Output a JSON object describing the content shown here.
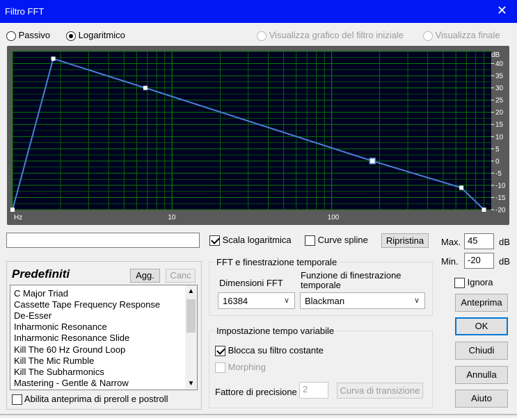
{
  "window": {
    "title": "Filtro FFT",
    "close_glyph": "✕"
  },
  "mode_options": [
    {
      "label": "Passivo",
      "selected": false
    },
    {
      "label": "Logaritmico",
      "selected": true
    }
  ],
  "view_options": [
    {
      "label": "Visualizza grafico del filtro iniziale",
      "enabled": false
    },
    {
      "label": "Visualizza finale",
      "enabled": false
    }
  ],
  "graph": {
    "x_unit": "Hz",
    "x_tick_labels": [
      "10",
      "100"
    ],
    "y_unit": "dB",
    "y_ticks": [
      "40",
      "35",
      "30",
      "25",
      "20",
      "15",
      "10",
      "5",
      "0",
      "-5",
      "-10",
      "-15",
      "-20"
    ],
    "colors": {
      "background": "#000020",
      "grid": "#0a7a0a",
      "curve": "#4a7fd8",
      "point": "#ffffff"
    },
    "curve_points": [
      {
        "freq": 1,
        "db": -20
      },
      {
        "freq": 1.8,
        "db": 42
      },
      {
        "freq": 6.8,
        "db": 30
      },
      {
        "freq": 180,
        "db": 0
      },
      {
        "freq": 650,
        "db": -11
      },
      {
        "freq": 900,
        "db": -20
      }
    ]
  },
  "controls": {
    "log_scale_label": "Scala logaritmica",
    "log_scale_checked": true,
    "spline_label": "Curve spline",
    "spline_checked": false,
    "reset_label": "Ripristina",
    "max_label": "Max.",
    "max_value": "45",
    "max_unit": "dB",
    "min_label": "Min.",
    "min_value": "-20",
    "min_unit": "dB"
  },
  "presets": {
    "title": "Predefiniti",
    "add_label": "Agg.",
    "delete_label": "Canc",
    "items": [
      "C Major Triad",
      "Cassette Tape Frequency Response",
      "De-Esser",
      "Inharmonic Resonance",
      "Inharmonic Resonance Slide",
      "Kill The 60 Hz  Ground Loop",
      "Kill The Mic Rumble",
      "Kill The Subharmonics",
      "Mastering - Gentle & Narrow"
    ],
    "preroll_label": "Abilita anteprima di preroll e postroll",
    "preroll_checked": false
  },
  "fft": {
    "group_title": "FFT e finestrazione temporale",
    "size_label": "Dimensioni FFT",
    "size_value": "16384",
    "window_label": "Funzione di finestrazione temporale",
    "window_value": "Blackman"
  },
  "timevar": {
    "group_title": "Impostazione tempo variabile",
    "lock_label": "Blocca su filtro costante",
    "lock_checked": true,
    "morph_label": "Morphing",
    "morph_checked": false,
    "precision_label": "Fattore di precisione",
    "precision_value": "2",
    "transition_label": "Curva di transizione"
  },
  "side": {
    "ignore_label": "Ignora",
    "ignore_checked": false,
    "preview_label": "Anteprima",
    "ok_label": "OK",
    "close_label": "Chiudi",
    "cancel_label": "Annulla",
    "help_label": "Aiuto"
  }
}
